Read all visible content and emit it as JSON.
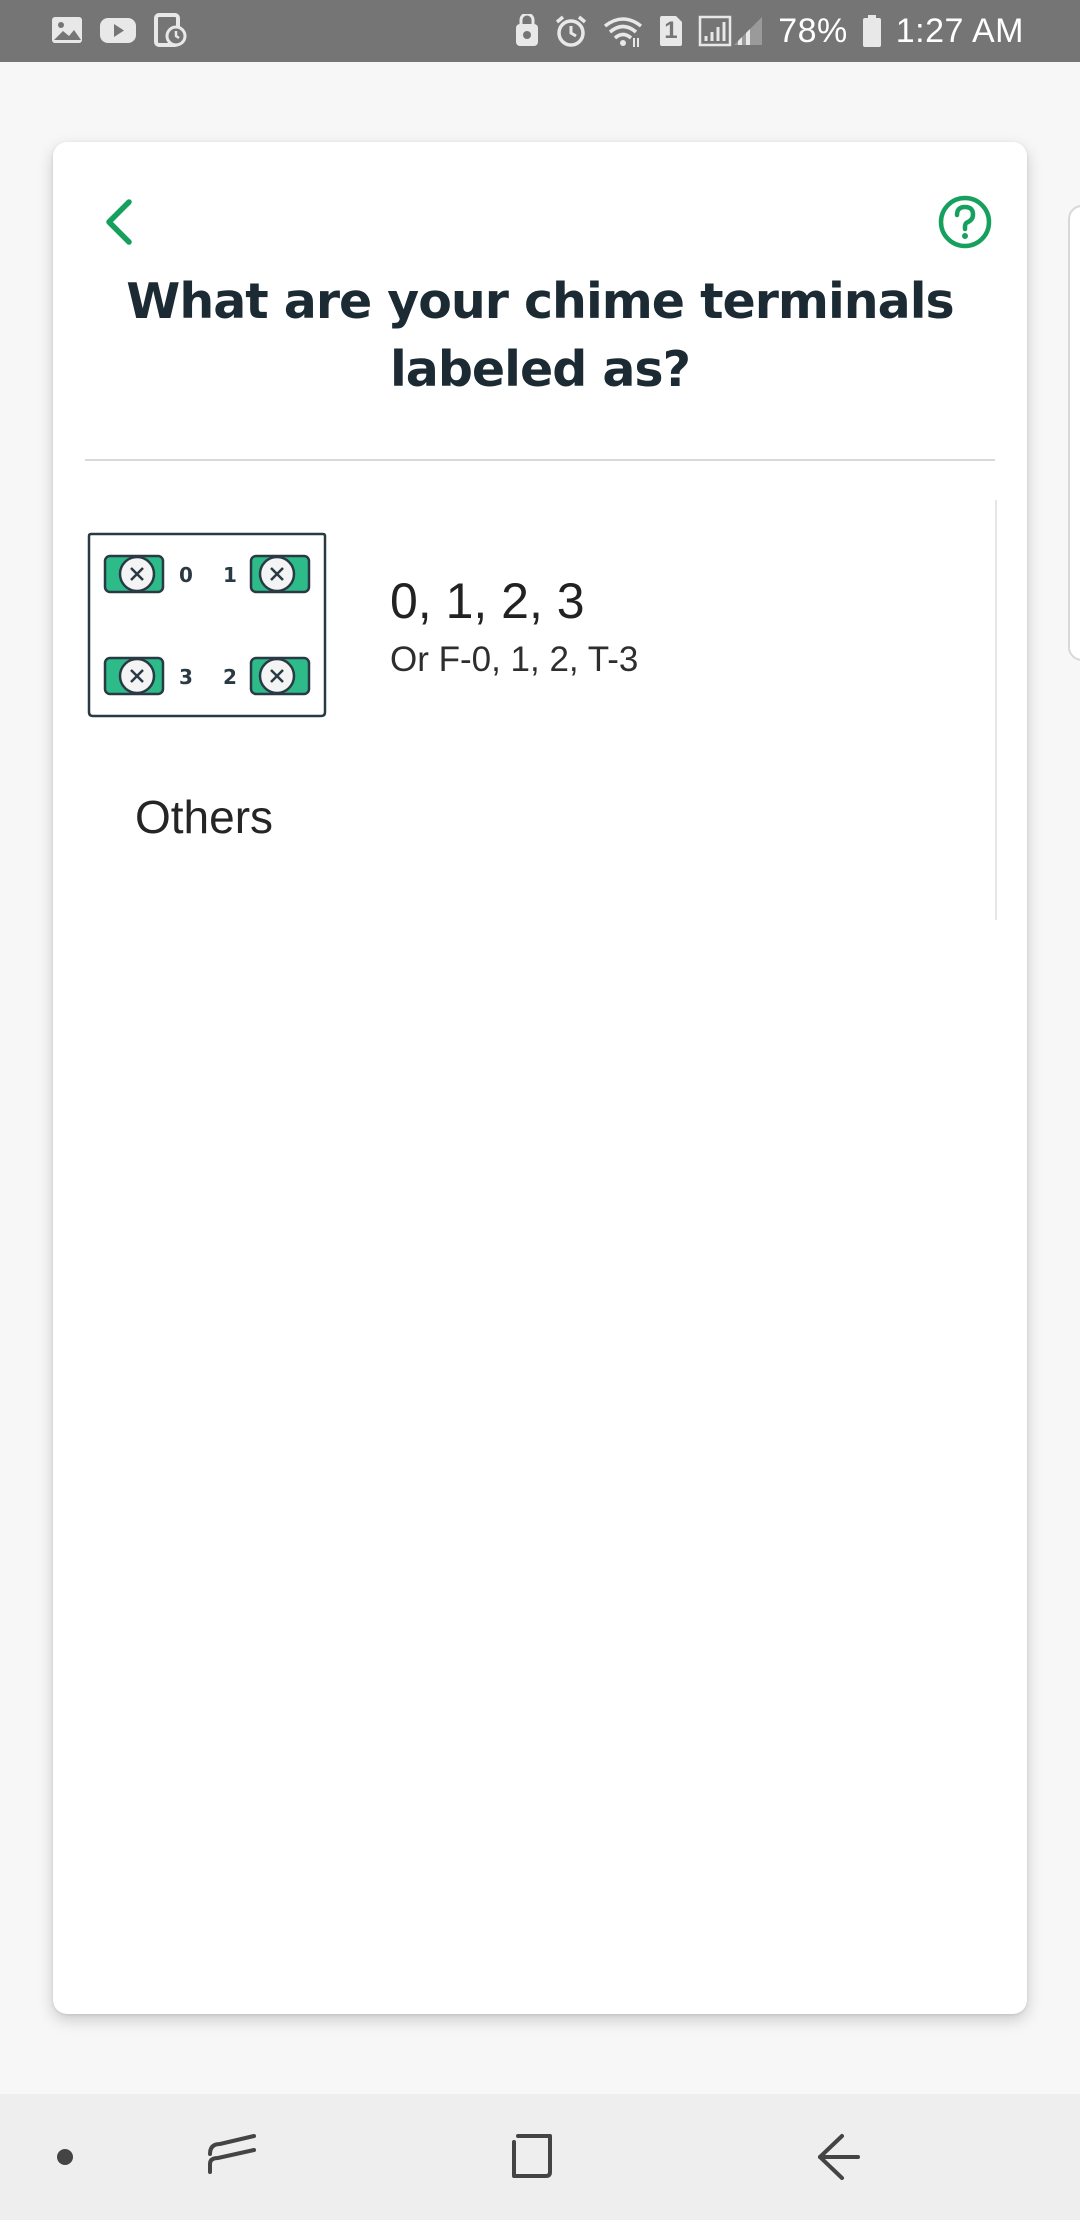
{
  "status_bar": {
    "battery": "78%",
    "time": "1:27 AM",
    "sim_slot": "1",
    "left_icons": [
      "gallery-icon",
      "youtube-icon",
      "screenshot-icon"
    ],
    "right_icons": [
      "vault-icon",
      "alarm-icon",
      "wifi-icon",
      "sim-icon",
      "signal-icon",
      "battery-icon"
    ]
  },
  "header": {
    "back_icon": "chevron-left-icon",
    "help_icon": "help-circle-icon",
    "title": "What are your chime terminals labeled as?"
  },
  "terminal_diagram": {
    "labels": [
      "0",
      "1",
      "3",
      "2"
    ]
  },
  "options": [
    {
      "title": "0, 1, 2, 3",
      "subtitle": "Or F-0, 1, 2, T-3"
    },
    {
      "title": "Others"
    }
  ],
  "nav_bar": {
    "buttons": [
      "dot-icon",
      "recent-apps-icon",
      "home-icon",
      "back-icon"
    ]
  },
  "colors": {
    "accent": "#16a05d",
    "terminal_green": "#2dbb8a",
    "title_text": "#1b2a33",
    "status_bar": "#757575"
  }
}
